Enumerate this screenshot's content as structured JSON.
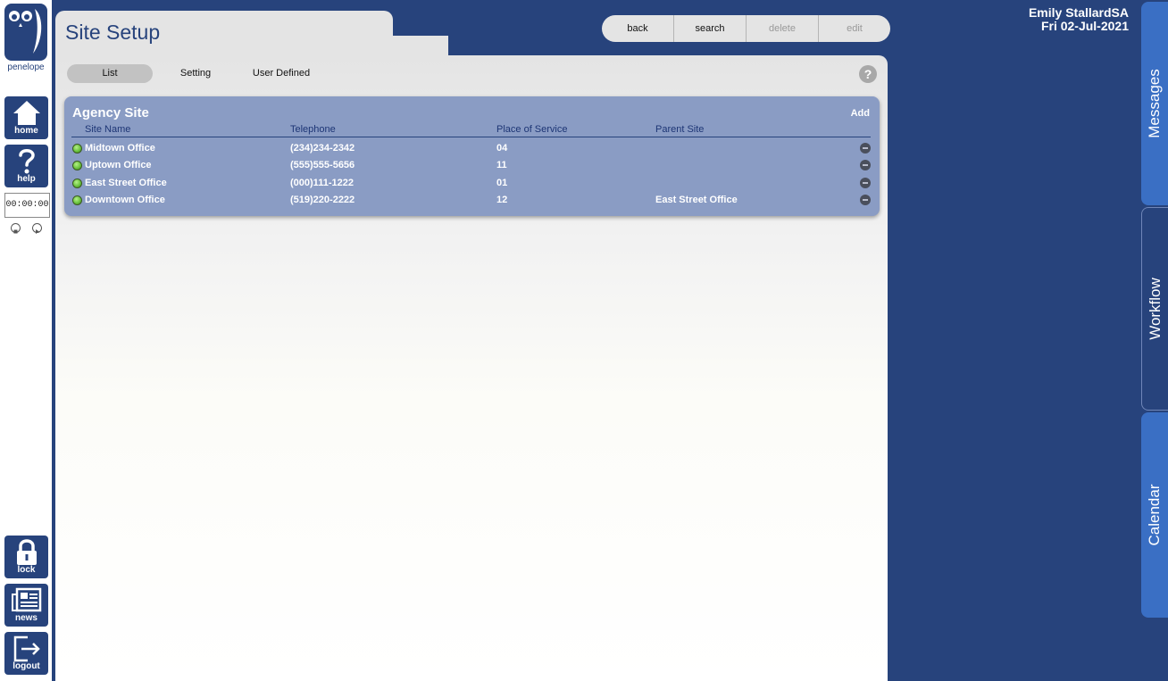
{
  "sidebar": {
    "brand": "penelope",
    "home_label": "home",
    "help_label": "help",
    "timer": "00:00:00",
    "lock_label": "lock",
    "news_label": "news",
    "logout_label": "logout"
  },
  "page": {
    "title": "Site Setup"
  },
  "toolbar": {
    "back": "back",
    "search": "search",
    "delete": "delete",
    "edit": "edit"
  },
  "tabs": [
    {
      "label": "List",
      "active": true
    },
    {
      "label": "Setting",
      "active": false
    },
    {
      "label": "User Defined",
      "active": false
    }
  ],
  "help_icon": "?",
  "user": {
    "name": "Emily StallardSA",
    "date": "Fri 02-Jul-2021"
  },
  "agency_site": {
    "title": "Agency Site",
    "add_label": "Add",
    "columns": [
      "Site Name",
      "Telephone",
      "Place of Service",
      "Parent Site"
    ],
    "rows": [
      {
        "site_name": "Midtown Office",
        "telephone": "(234)234-2342",
        "place_of_service": "04",
        "parent_site": ""
      },
      {
        "site_name": "Uptown Office",
        "telephone": "(555)555-5656",
        "place_of_service": "11",
        "parent_site": ""
      },
      {
        "site_name": "East Street Office",
        "telephone": "(000)111-1222",
        "place_of_service": "01",
        "parent_site": ""
      },
      {
        "site_name": "Downtown Office",
        "telephone": "(519)220-2222",
        "place_of_service": "12",
        "parent_site": "East Street Office"
      }
    ]
  },
  "side_tabs": {
    "messages": "Messages",
    "workflow": "Workflow",
    "calendar": "Calendar"
  },
  "colors": {
    "brand_blue": "#27437c",
    "card": "#8a9cc4",
    "status_green": "#6ac33e"
  }
}
